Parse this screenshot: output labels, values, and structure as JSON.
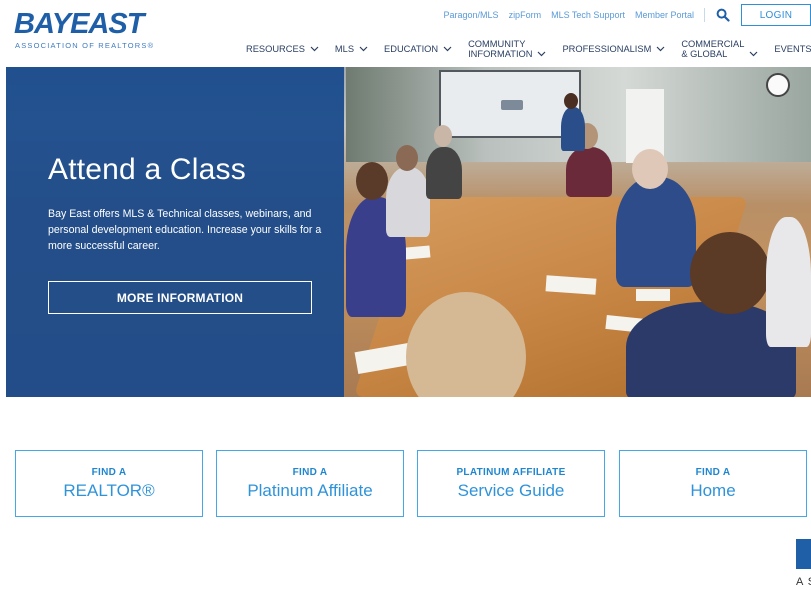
{
  "brand": {
    "logo_word": "BAYEAST",
    "logo_subtitle": "ASSOCIATION OF REALTORS®",
    "primary_color": "#1f5fa8",
    "accent_color": "#45a7e6"
  },
  "utility_nav": {
    "links": [
      "Paragon/MLS",
      "zipForm",
      "MLS Tech Support",
      "Member Portal"
    ],
    "search_icon": "search-icon",
    "login_label": "LOGIN"
  },
  "main_nav": {
    "items": [
      {
        "line1": "RESOURCES",
        "line2": ""
      },
      {
        "line1": "MLS",
        "line2": ""
      },
      {
        "line1": "EDUCATION",
        "line2": ""
      },
      {
        "line1": "COMMUNITY",
        "line2": "INFORMATION"
      },
      {
        "line1": "PROFESSIONALISM",
        "line2": ""
      },
      {
        "line1": "COMMERCIAL",
        "line2": "& GLOBAL"
      },
      {
        "line1": "EVENTS",
        "line2": ""
      }
    ]
  },
  "hero": {
    "title": "Attend a Class",
    "text": "Bay East offers MLS & Technical classes, webinars, and personal development education. Increase your skills for a more successful career.",
    "button_label": "MORE INFORMATION",
    "overlay_color": "#18498c"
  },
  "find_boxes": [
    {
      "small": "FIND A",
      "big": "REALTOR®"
    },
    {
      "small": "FIND A",
      "big": "Platinum Affiliate"
    },
    {
      "small": "PLATINUM AFFILIATE",
      "big": "Service Guide"
    },
    {
      "small": "FIND A",
      "big": "Home"
    }
  ],
  "corner_fragment": {
    "text": "A S"
  }
}
